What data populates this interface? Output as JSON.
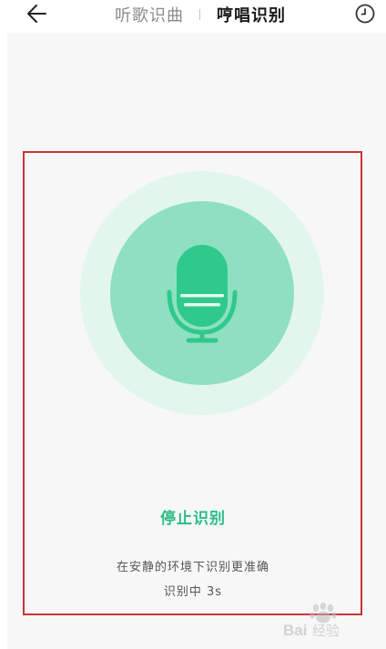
{
  "header": {
    "back_icon": "arrow-left-icon",
    "tabs": [
      {
        "label": "听歌识曲",
        "active": false
      },
      {
        "label": "哼唱识别",
        "active": true
      }
    ],
    "history_icon": "clock-icon"
  },
  "main": {
    "mic_icon": "microphone-icon",
    "stop_label": "停止识别",
    "hint": "在安静的环境下识别更准确",
    "status": "识别中 3s"
  },
  "watermark": {
    "text": "Baidu经验"
  },
  "colors": {
    "accent": "#2bbd85",
    "mic_icon": "#2fc98c",
    "ring_outer": "#e3f6ee",
    "ring_inner": "#8fe0c0",
    "highlight_border": "#c9353a",
    "background": "#f7f7f7"
  }
}
